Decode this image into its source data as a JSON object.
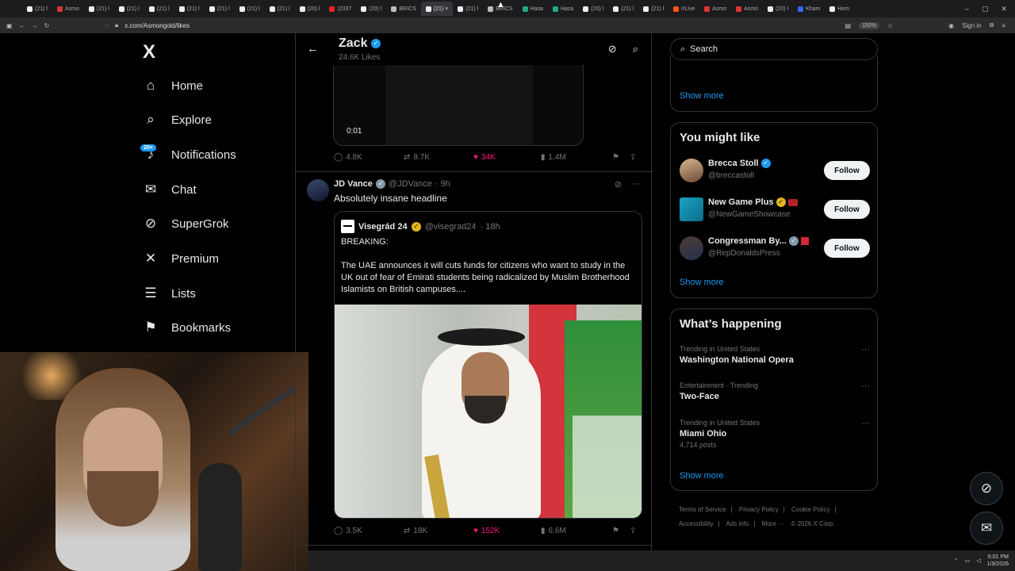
{
  "browser": {
    "tabs": [
      "(21) l",
      "Asmo",
      "(21) l",
      "(21) l",
      "(21) l",
      "(21) l",
      "(21) l",
      "(21) l",
      "(21) l",
      "(20) l",
      "(2337",
      "(20) l",
      "BRICS",
      "(21) ×",
      "(21) l",
      "BRICS",
      "Hasa",
      "Hasa",
      "(20) l",
      "(21) l",
      "(21) l",
      "r/Live",
      "Asmo",
      "Asmo",
      "(20) l",
      "Kham",
      "Hom"
    ],
    "url": "x.com/Asmongold/likes",
    "zoom": "150%",
    "sign_in": "Sign in"
  },
  "nav": {
    "logo": "X",
    "items": [
      {
        "label": "Home",
        "icon": "home-icon"
      },
      {
        "label": "Explore",
        "icon": "search-icon"
      },
      {
        "label": "Notifications",
        "icon": "bell-icon"
      },
      {
        "label": "Chat",
        "icon": "mail-icon"
      },
      {
        "label": "SuperGrok",
        "icon": "grok-icon"
      },
      {
        "label": "Premium",
        "icon": "x-icon"
      },
      {
        "label": "Lists",
        "icon": "list-icon"
      },
      {
        "label": "Bookmarks",
        "icon": "bookmark-icon"
      }
    ],
    "notif_badge": "20+"
  },
  "header": {
    "name": "Zack",
    "likes": "24.6K Likes"
  },
  "post1": {
    "video_time": "0:01",
    "replies": "4.8K",
    "reposts": "8.7K",
    "likes": "34K",
    "views": "1.4M"
  },
  "post2": {
    "name": "JD Vance",
    "handle": "@JDVance",
    "time": "· 9h",
    "text": "Absolutely insane headline",
    "quote": {
      "name": "Visegrád 24",
      "handle": "@visegrad24",
      "time": "· 18h",
      "text": "BREAKING:\n\nThe UAE announces it will cuts funds for citizens who want to study in the UK out of fear of Emirati students being radicalized by Muslim Brotherhood Islamists on British campuses...."
    },
    "replies": "3.5K",
    "reposts": "18K",
    "likes": "152K",
    "views": "6.6M"
  },
  "right": {
    "search_placeholder": "Search",
    "show_more": "Show more",
    "you_might_like_title": "You might like",
    "suggestions": [
      {
        "name": "Brecca Stoll",
        "handle": "@breccastoll",
        "follow": "Follow"
      },
      {
        "name": "New Game Plus",
        "handle": "@NewGameShowcase",
        "follow": "Follow"
      },
      {
        "name": "Congressman By...",
        "handle": "@RepDonaldsPress",
        "follow": "Follow"
      }
    ],
    "happening_title": "What’s happening",
    "trends": [
      {
        "context": "Trending in United States",
        "title": "Washington National Opera",
        "count": ""
      },
      {
        "context": "Entertainment · Trending",
        "title": "Two-Face",
        "count": ""
      },
      {
        "context": "Trending in United States",
        "title": "Miami Ohio",
        "count": "4,714 posts"
      }
    ],
    "footer": [
      "Terms of Service",
      "|",
      "Privacy Policy",
      "|",
      "Cookie Policy",
      "|",
      "Accessibility",
      "|",
      "Ads info",
      "|",
      "More ···",
      "© 2026 X Corp."
    ]
  },
  "taskbar": {
    "time": "6:01 PM",
    "date": "1/9/2026"
  },
  "colors": {
    "accent": "#1d9bf0",
    "like": "#f91880",
    "gold_check": "#e2b719"
  }
}
